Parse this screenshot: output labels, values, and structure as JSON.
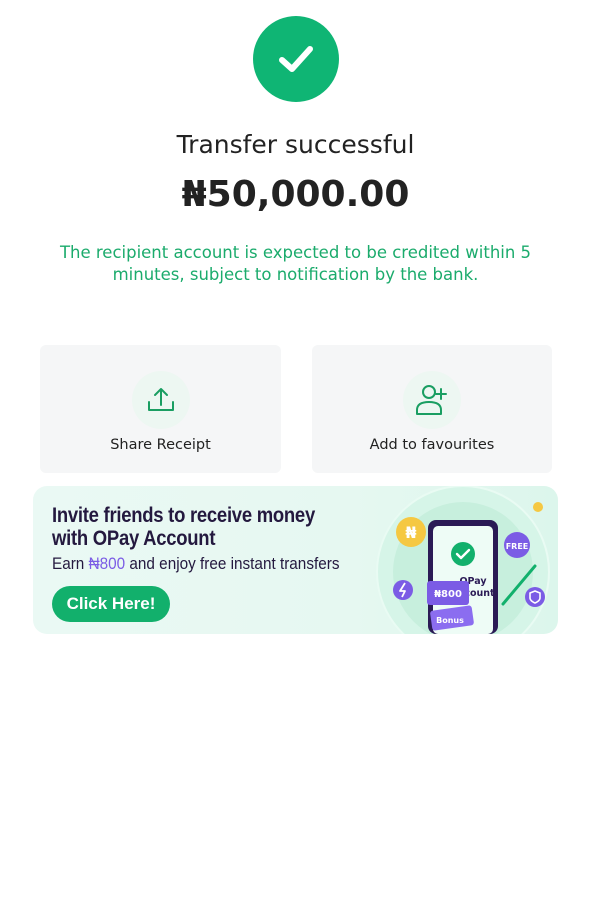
{
  "status": {
    "title": "Transfer successful",
    "amount": "₦50,000.00",
    "note": "The recipient account is expected to be credited within 5 minutes, subject to notification by the bank."
  },
  "actions": [
    {
      "label": "Share Receipt",
      "icon": "share-icon"
    },
    {
      "label": "Add to favourites",
      "icon": "add-user-icon"
    }
  ],
  "banner": {
    "heading": "Invite friends to receive money with OPay Account",
    "sub_prefix": "Earn ",
    "sub_amount": "₦800",
    "sub_suffix": " and enjoy free instant transfers",
    "cta": "Click Here!",
    "art": {
      "phone_line1": "OPay",
      "phone_line2": "Account",
      "ticket_amount": "₦800",
      "ticket_label": "Bonus",
      "free_badge": "FREE",
      "coin_symbol": "₦"
    }
  },
  "colors": {
    "success_green": "#0fb574",
    "note_green": "#1bab6c",
    "brand_purple": "#7b5ce5",
    "cta_green": "#12b06c"
  }
}
